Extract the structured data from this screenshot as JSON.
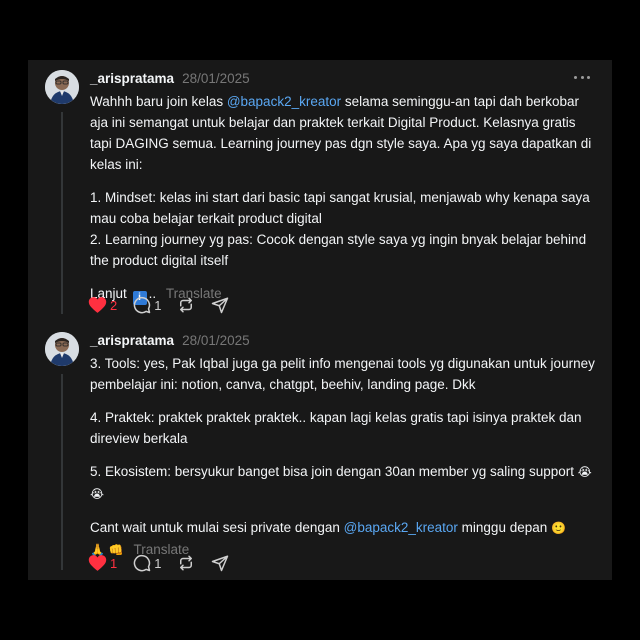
{
  "posts": [
    {
      "username": "_arispratama",
      "timestamp": "28/01/2025",
      "paragraphs": {
        "p1_a": "Wahhh baru join kelas ",
        "p1_mention": "@bapack2_kreator",
        "p1_b": " selama seminggu-an tapi dah berkobar aja ini semangat untuk belajar dan praktek terkait Digital Product. Kelasnya gratis tapi DAGING semua. Learning journey pas dgn style saya. Apa yg saya dapatkan di kelas ini:",
        "p2": "1. Mindset: kelas ini start dari basic tapi sangat krusial, menjawab why kenapa saya mau coba belajar terkait product digital",
        "p3": "2. Learning journey yg pas: Cocok dengan style saya yg ingin bnyak belajar behind the product digital itself",
        "p4_a": "Lanjut",
        "p4_badge": "i",
        "p4_b": ".."
      },
      "translate_label": "Translate",
      "likes": "2",
      "replies": "1"
    },
    {
      "username": "_arispratama",
      "timestamp": "28/01/2025",
      "paragraphs": {
        "p1": "3. Tools: yes, Pak Iqbal juga ga pelit info mengenai tools yg digunakan untuk journey pembelajar ini: notion, canva, chatgpt, beehiv, landing page. Dkk",
        "p2": "4. Praktek: praktek praktek praktek.. kapan lagi kelas gratis tapi isinya praktek dan direview berkala",
        "p3_a": "5. Ekosistem: bersyukur banget bisa join dengan 30an member yg saling support",
        "p3_emoji": "😭😭",
        "p4_a": "Cant wait untuk mulai sesi private dengan ",
        "p4_mention": "@bapack2_kreator",
        "p4_b": " minggu depan ",
        "p4_emoji1": "🙂",
        "p4_emoji2": "🙏 👊"
      },
      "translate_label": "Translate",
      "likes": "1",
      "replies": "1"
    }
  ],
  "colors": {
    "background": "#000000",
    "card": "#181818",
    "text": "#f3f5f7",
    "muted": "#777777",
    "mention": "#5aa7f2",
    "like": "#ff3040"
  },
  "icons": [
    "avatar",
    "more-icon",
    "heart-icon",
    "reply-icon",
    "repost-icon",
    "share-icon"
  ]
}
